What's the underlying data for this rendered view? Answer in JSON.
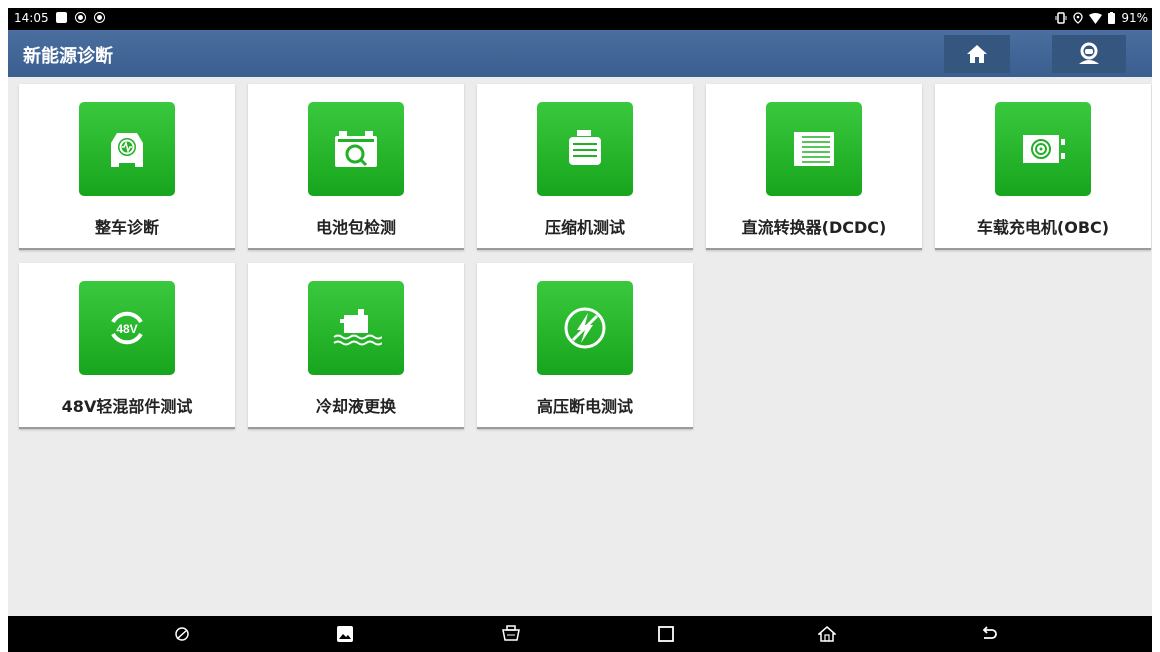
{
  "status_bar": {
    "time": "14:05",
    "battery": "91%"
  },
  "header": {
    "title": "新能源诊断"
  },
  "tiles": [
    {
      "label": "整车诊断",
      "icon": "car-diagnosis-icon"
    },
    {
      "label": "电池包检测",
      "icon": "battery-pack-icon"
    },
    {
      "label": "压缩机测试",
      "icon": "compressor-icon"
    },
    {
      "label": "直流转换器(DCDC)",
      "icon": "dcdc-converter-icon"
    },
    {
      "label": "车载充电机(OBC)",
      "icon": "onboard-charger-icon"
    },
    {
      "label": "48V轻混部件测试",
      "icon": "48v-mild-hybrid-icon",
      "icon_text": "48V"
    },
    {
      "label": "冷却液更换",
      "icon": "coolant-icon"
    },
    {
      "label": "高压断电测试",
      "icon": "high-voltage-off-icon"
    }
  ],
  "colors": {
    "header": "#3f6494",
    "tile_green": "#22b026",
    "background": "#ececec"
  }
}
